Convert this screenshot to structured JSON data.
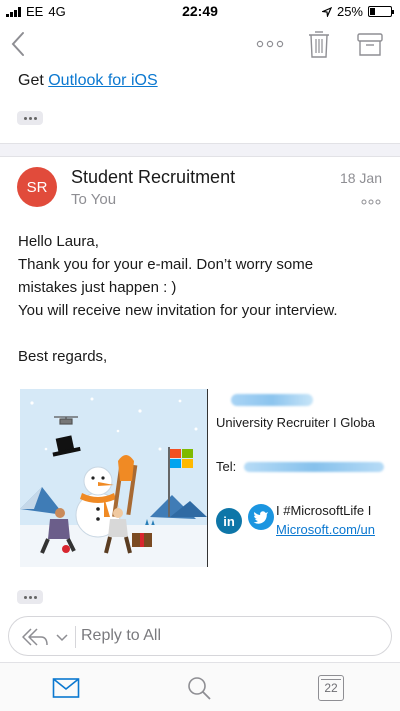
{
  "status_bar": {
    "carrier": "EE",
    "network": "4G",
    "time": "22:49",
    "battery": "25%",
    "battery_level": 0.25,
    "icons": [
      "signal-bars-icon",
      "location-arrow-icon",
      "battery-icon"
    ]
  },
  "toolbar": {
    "icons": [
      "back-chevron-icon",
      "more-options-icon",
      "trash-icon",
      "archive-icon"
    ]
  },
  "previous_email": {
    "text_prefix": "Get ",
    "link_text": "Outlook for iOS"
  },
  "email": {
    "avatar_initials": "SR",
    "avatar_color": "#e14b3b",
    "sender": "Student Recruitment",
    "recipient": "To You",
    "date": "18 Jan",
    "body": [
      "Hello Laura,",
      "Thank you for your e-mail. Don’t worry some",
      "mistakes just happen : )",
      "You will receive new invitation for your interview.",
      "",
      "Best regards,"
    ]
  },
  "signature": {
    "title": "University Recruiter I Globa",
    "tel_label": "Tel:",
    "linkedin_label": "in",
    "hashtag": "I #MicrosoftLife I",
    "link": "Microsoft.com/un"
  },
  "reply": {
    "label": "Reply to All"
  },
  "tabbar": {
    "calendar_day": "22",
    "icons": [
      "mail-icon",
      "search-icon",
      "calendar-icon"
    ]
  },
  "colors": {
    "link": "#0b78d0",
    "linkedin": "#0e76a8",
    "twitter": "#1b95e0",
    "tab_active": "#0b78d0"
  }
}
